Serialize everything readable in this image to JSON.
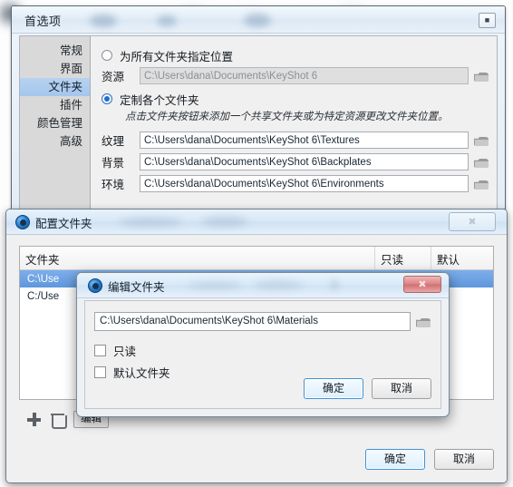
{
  "prefs_window": {
    "title": "首选项",
    "close_icon": "close-icon",
    "sidebar": {
      "items": [
        {
          "label": "常规",
          "selected": false
        },
        {
          "label": "界面",
          "selected": false
        },
        {
          "label": "文件夹",
          "selected": true
        },
        {
          "label": "插件",
          "selected": false
        },
        {
          "label": "颜色管理",
          "selected": false
        },
        {
          "label": "高级",
          "selected": false
        }
      ]
    },
    "options": {
      "radio_all_folders": {
        "label": "为所有文件夹指定位置",
        "selected": false
      },
      "radio_custom_folders": {
        "label": "定制各个文件夹",
        "selected": true
      },
      "resource_label": "资源",
      "resource_path": "C:\\Users\\dana\\Documents\\KeyShot 6",
      "hint": "点击文件夹按钮来添加一个共享文件夹或为特定资源更改文件夹位置。",
      "paths": [
        {
          "label": "纹理",
          "value": "C:\\Users\\dana\\Documents\\KeyShot 6\\Textures"
        },
        {
          "label": "背景",
          "value": "C:\\Users\\dana\\Documents\\KeyShot 6\\Backplates"
        },
        {
          "label": "环境",
          "value": "C:\\Users\\dana\\Documents\\KeyShot 6\\Environments"
        }
      ]
    }
  },
  "configure_window": {
    "title": "配置文件夹",
    "app_icon": "keyshot-icon",
    "close_icon": "close-icon",
    "table": {
      "headers": [
        "文件夹",
        "只读",
        "默认"
      ],
      "rows": [
        {
          "folder": "C:\\Use",
          "readonly": "",
          "default": "",
          "selected": true
        },
        {
          "folder": "C:/Use",
          "readonly": "",
          "default": "",
          "selected": false
        }
      ]
    },
    "toolbar": {
      "add_icon": "plus-icon",
      "delete_icon": "trash-icon",
      "edit_label": "编辑"
    },
    "footer": {
      "ok_label": "确定",
      "cancel_label": "取消"
    }
  },
  "edit_window": {
    "title": "编辑文件夹",
    "app_icon": "keyshot-icon",
    "close_icon": "close-icon",
    "path_value": "C:\\Users\\dana\\Documents\\KeyShot 6\\Materials",
    "browse_icon": "folder-icon",
    "checkboxes": [
      {
        "label": "只读",
        "checked": false
      },
      {
        "label": "默认文件夹",
        "checked": false
      }
    ],
    "footer": {
      "ok_label": "确定",
      "cancel_label": "取消"
    }
  },
  "colors": {
    "accent_blue": "#1a6fd4",
    "selection_blue": "#5f97dd",
    "close_red": "#cf6f6f",
    "sidebar_bg": "#d9d9d9",
    "panel_bg": "#f0f0f0"
  }
}
